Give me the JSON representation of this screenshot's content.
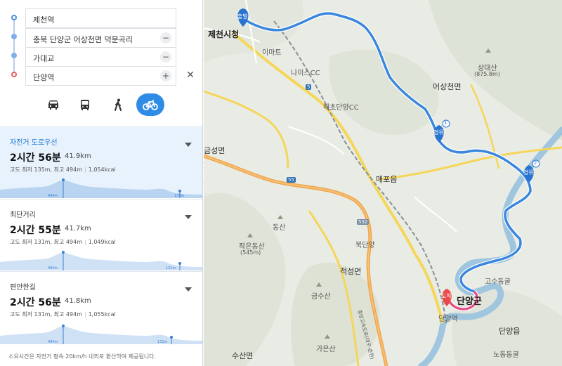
{
  "waypoints": [
    {
      "label": "제천역",
      "dot_color": "#4a8fe0",
      "action": ""
    },
    {
      "label": "충북 단양군 어상천면 덕문곡리",
      "dot_color": "#7fb0ea",
      "action": "−"
    },
    {
      "label": "가대교",
      "dot_color": "#7fb0ea",
      "action": "−"
    },
    {
      "label": "단양역",
      "dot_color": "#ef5b5b",
      "action": "+"
    }
  ],
  "close_label": "✕",
  "modes": [
    {
      "name": "car",
      "icon": "car-icon",
      "active": false
    },
    {
      "name": "bus",
      "icon": "bus-icon",
      "active": false
    },
    {
      "name": "walk",
      "icon": "walk-icon",
      "active": false
    },
    {
      "name": "bicycle",
      "icon": "bicycle-icon",
      "active": true
    }
  ],
  "routes": [
    {
      "name": "자전거 도로우선",
      "time": "2시간 56분",
      "distance": "41.9km",
      "elevation": "고도 최저 135m, 최고 494m",
      "kcal": "1,054kcal",
      "profile_max": "494m",
      "profile_min": "135m",
      "selected": true
    },
    {
      "name": "최단거리",
      "time": "2시간 55분",
      "distance": "41.7km",
      "elevation": "고도 최저 131m, 최고 494m",
      "kcal": "1,049kcal",
      "profile_max": "494m",
      "profile_min": "131m",
      "selected": false
    },
    {
      "name": "편안한길",
      "time": "2시간 56분",
      "distance": "41.8km",
      "elevation": "고도 최저 131m, 최고 494m",
      "kcal": "1,055kcal",
      "profile_max": "494m",
      "profile_min": "131m",
      "selected": false
    }
  ],
  "footnote": "소요시간은 자전거 평속 20km/h 내외로 환산하여 제공됩니다.",
  "map": {
    "start_label": "출발",
    "end_label": "도착",
    "via_label": "경유",
    "via1_num": "1",
    "via2_num": "2",
    "places": {
      "jecheon_city_hall": "제천시청",
      "emart": "이마트",
      "nice_cc": "나이스CC",
      "haecho_cc": "해초단양CC",
      "sangdaesan": "상대산",
      "sangdaesan_h": "(875.8m)",
      "eosangcheon": "어상천면",
      "geumseong": "금성면",
      "maepo": "매포읍",
      "dongsan": "동산",
      "jakseongsan": "작은동산",
      "jakseongsan_h": "(545m)",
      "bukdanyang": "북단양",
      "jeokseong": "적성면",
      "gosu_cave": "고수동굴",
      "danyang": "단양군",
      "danyang_station": "단양역",
      "geumsusan": "금수산",
      "gaeunsan": "가은산",
      "sugeong": "수산면",
      "danyang_eup": "단양읍",
      "nodong_cave": "노동동굴",
      "highway": "중앙고속도로(대구-춘천)"
    },
    "road_badges": {
      "r5": "5",
      "r55": "55",
      "r532": "532"
    },
    "colors": {
      "route": "#3a86dd",
      "route_end": "#e8508a",
      "start_pin": "#2a73cf",
      "end_pin": "#e84a4a",
      "water": "#9fc5df"
    }
  }
}
